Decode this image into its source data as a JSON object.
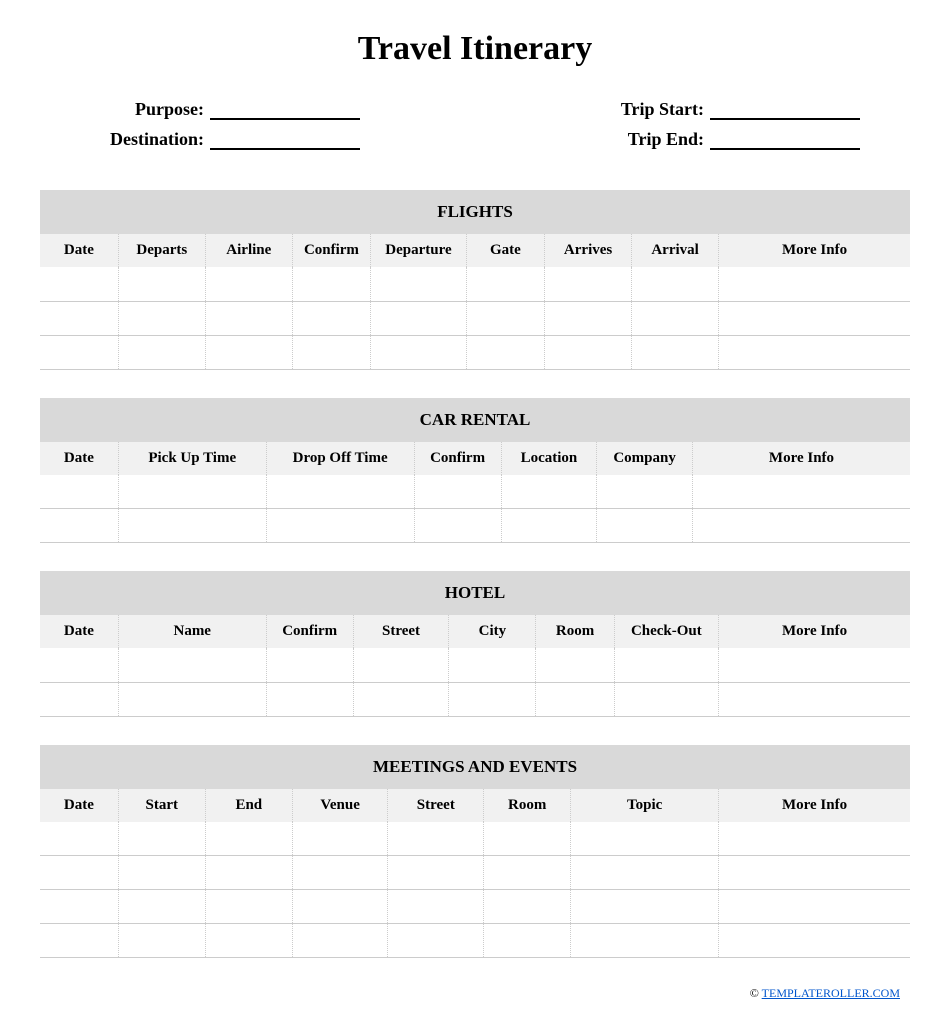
{
  "title": "Travel Itinerary",
  "header": {
    "purpose_label": "Purpose:",
    "destination_label": "Destination:",
    "trip_start_label": "Trip Start:",
    "trip_end_label": "Trip End:",
    "purpose_value": "",
    "destination_value": "",
    "trip_start_value": "",
    "trip_end_value": ""
  },
  "sections": {
    "flights": {
      "title": "FLIGHTS",
      "columns": [
        "Date",
        "Departs",
        "Airline",
        "Confirm",
        "Departure",
        "Gate",
        "Arrives",
        "Arrival",
        "More Info"
      ],
      "row_count": 3
    },
    "car_rental": {
      "title": "CAR RENTAL",
      "columns": [
        "Date",
        "Pick Up Time",
        "Drop Off Time",
        "Confirm",
        "Location",
        "Company",
        "More Info"
      ],
      "row_count": 2
    },
    "hotel": {
      "title": "HOTEL",
      "columns": [
        "Date",
        "Name",
        "Confirm",
        "Street",
        "City",
        "Room",
        "Check-Out",
        "More Info"
      ],
      "row_count": 2
    },
    "meetings": {
      "title": "MEETINGS AND EVENTS",
      "columns": [
        "Date",
        "Start",
        "End",
        "Venue",
        "Street",
        "Room",
        "Topic",
        "More Info"
      ],
      "row_count": 4
    }
  },
  "footer": {
    "copyright": "©",
    "link_text": "TEMPLATEROLLER.COM"
  }
}
